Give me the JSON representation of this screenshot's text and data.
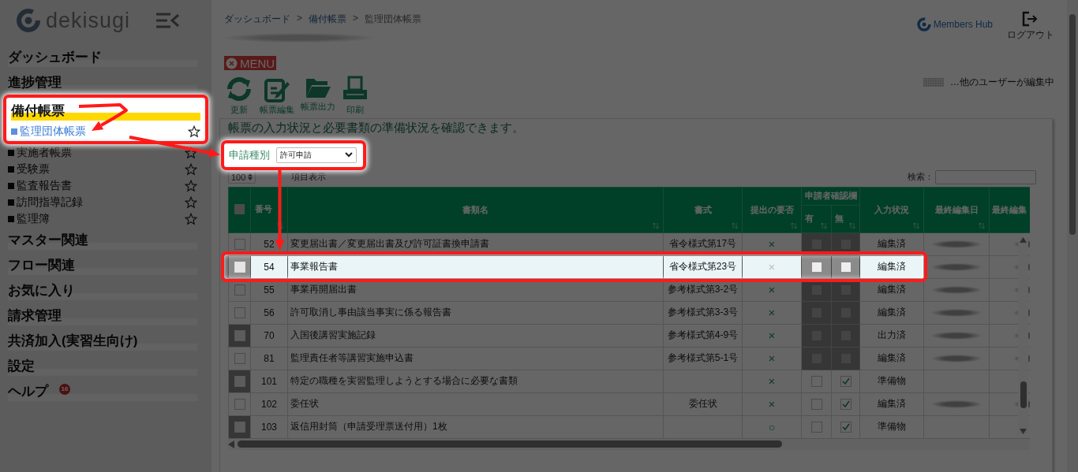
{
  "sidebar": {
    "logo": "dekisugi",
    "items": [
      {
        "label": "ダッシュボード",
        "expanded": false
      },
      {
        "label": "進捗管理",
        "expanded": false
      },
      {
        "label": "備付帳票",
        "expanded": true,
        "highlighted": true,
        "children": [
          {
            "label": "監理団体帳票",
            "selected": true,
            "favorite": false
          },
          {
            "label": "実施者帳票",
            "selected": false,
            "favorite": false
          },
          {
            "label": "受験票",
            "selected": false,
            "favorite": false
          },
          {
            "label": "監査報告書",
            "selected": false,
            "favorite": false
          },
          {
            "label": "訪問指導記録",
            "selected": false,
            "favorite": false
          },
          {
            "label": "監理簿",
            "selected": false,
            "favorite": false
          }
        ]
      },
      {
        "label": "マスター関連",
        "expanded": false
      },
      {
        "label": "フロー関連",
        "expanded": false
      },
      {
        "label": "お気に入り",
        "expanded": false
      },
      {
        "label": "請求管理",
        "expanded": false
      },
      {
        "label": "共済加入(実習生向け)",
        "expanded": false
      },
      {
        "label": "設定",
        "expanded": false
      },
      {
        "label": "ヘルプ",
        "expanded": false,
        "badge": "16"
      }
    ]
  },
  "header": {
    "breadcrumb": [
      {
        "kind": "link",
        "label": "ダッシュボード"
      },
      {
        "kind": "separator",
        "label": ">"
      },
      {
        "kind": "link",
        "label": "備付帳票"
      },
      {
        "kind": "separator",
        "label": ">"
      },
      {
        "kind": "current",
        "label": "監理団体帳票"
      }
    ],
    "menu_button": "MENU",
    "toolbar": [
      {
        "kind": "refresh",
        "label": "更新"
      },
      {
        "kind": "edit",
        "label": "帳票編集"
      },
      {
        "kind": "folder",
        "label": "帳票出力"
      },
      {
        "kind": "print",
        "label": "印刷"
      }
    ],
    "brand": "Members Hub",
    "logout": "ログアウト",
    "legend": "…他のユーザーが編集中"
  },
  "content": {
    "description": "帳票の入力状況と必要書類の準備状況を確認できます。",
    "filter": {
      "label": "申請種別",
      "value": "許可申請",
      "highlighted": true
    },
    "page_length": "100",
    "column_toggle": "項目表示",
    "search_label": "検索：",
    "table": {
      "select_all_checked": false,
      "columns": [
        {
          "label": "番号"
        },
        {
          "label": "書類名"
        },
        {
          "label": "書式"
        },
        {
          "label": "提出の要否"
        },
        {
          "label": "申請者確認欄",
          "children": [
            {
              "label": "有"
            },
            {
              "label": "無"
            }
          ]
        },
        {
          "label": "入力状況"
        },
        {
          "label": "最終編集日"
        },
        {
          "label": "最終編集"
        }
      ],
      "rows": [
        {
          "no": "52",
          "name": "変更届出書／変更届出書及び許可証書換申請書",
          "form": "省令様式第17号",
          "required": "×",
          "has": false,
          "none": false,
          "locked": true,
          "marked": false,
          "status": "編集済",
          "redacted": true,
          "highlighted": false
        },
        {
          "no": "54",
          "name": "事業報告書",
          "form": "省令様式第23号",
          "required": "×",
          "has": false,
          "none": false,
          "locked": true,
          "marked": true,
          "status": "編集済",
          "redacted": true,
          "highlighted": true
        },
        {
          "no": "55",
          "name": "事業再開届出書",
          "form": "参考様式第3-2号",
          "required": "×",
          "has": false,
          "none": false,
          "locked": true,
          "marked": false,
          "status": "編集済",
          "redacted": true,
          "highlighted": false
        },
        {
          "no": "56",
          "name": "許可取消し事由該当事実に係る報告書",
          "form": "参考様式第3-3号",
          "required": "×",
          "has": false,
          "none": false,
          "locked": true,
          "marked": false,
          "status": "編集済",
          "redacted": true,
          "highlighted": false
        },
        {
          "no": "70",
          "name": "入国後講習実施記録",
          "form": "参考様式第4-9号",
          "required": "×",
          "has": false,
          "none": false,
          "locked": true,
          "marked": true,
          "status": "出力済",
          "redacted": true,
          "highlighted": false
        },
        {
          "no": "81",
          "name": "監理責任者等講習実施申込書",
          "form": "参考様式第5-1号",
          "required": "×",
          "has": false,
          "none": false,
          "locked": true,
          "marked": false,
          "status": "編集済",
          "redacted": true,
          "highlighted": false
        },
        {
          "no": "101",
          "name": "特定の職種を実習監理しようとする場合に必要な書類",
          "required": "×",
          "has": false,
          "none": true,
          "locked": false,
          "marked": true,
          "status": "準備物",
          "redacted": false,
          "highlighted": false
        },
        {
          "no": "102",
          "name": "委任状",
          "form": "委任状",
          "required": "×",
          "has": false,
          "none": true,
          "locked": false,
          "marked": false,
          "status": "編集済",
          "redacted": true,
          "highlighted": false
        },
        {
          "no": "103",
          "name": "返信用封筒（申請受理票送付用）1枚",
          "required": "○",
          "has": false,
          "none": true,
          "locked": false,
          "marked": true,
          "status": "準備物",
          "redacted": false,
          "highlighted": false
        }
      ]
    }
  }
}
